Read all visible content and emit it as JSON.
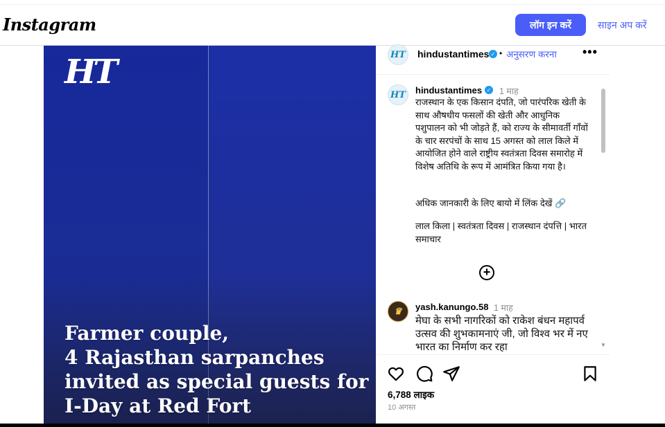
{
  "header": {
    "logo": "Instagram",
    "login_label": "लॉग इन करें",
    "signup_label": "साइन अप करें"
  },
  "photo": {
    "brand_mark": "HT",
    "headline_lines": [
      "Farmer couple,",
      "4 Rajasthan sarpanches",
      "invited as special guests for",
      "I-Day at Red Fort"
    ]
  },
  "post_header": {
    "avatar_text": "HT",
    "username": "hindustantimes",
    "follow_label": "अनुसरण करना",
    "separator": "•",
    "more_icon": "more-options-icon"
  },
  "caption": {
    "username": "hindustantimes",
    "time": "1 माह",
    "text": "राजस्थान के एक किसान दंपति, जो पारंपरिक खेती के साथ औषधीय फसलों की खेती और आधुनिक पशुपालन को भी जोड़ते हैं, को राज्य के सीमावर्ती गाँवों के चार सरपंचों के साथ 15 अगस्त को लाल किले में आयोजित होने वाले राष्ट्रीय स्वतंत्रता दिवस समारोह में विशेष अतिथि के रूप में आमंत्रित किया गया है।",
    "link_line": "अधिक जानकारी के लिए बायो में लिंक देखें 🔗",
    "tags": "लाल किला | स्वतंत्रता दिवस | राजस्थान दंपत्ति | भारत समाचार"
  },
  "comment": {
    "username": "yash.kanungo.58",
    "time": "1 माह",
    "text": "मेघा के सभी नागरिकों को राकेश बंधन महापर्व उत्सव की शुभकामनाएं जी, जो विश्व भर में नए भारत का निर्माण कर रहा"
  },
  "footer": {
    "likes": "6,788 लाइक",
    "date": "10 अगस्त"
  },
  "colors": {
    "accent": "#4a5df9",
    "verified": "#1d9bf0",
    "photo_bg": "#1d2b8a"
  }
}
